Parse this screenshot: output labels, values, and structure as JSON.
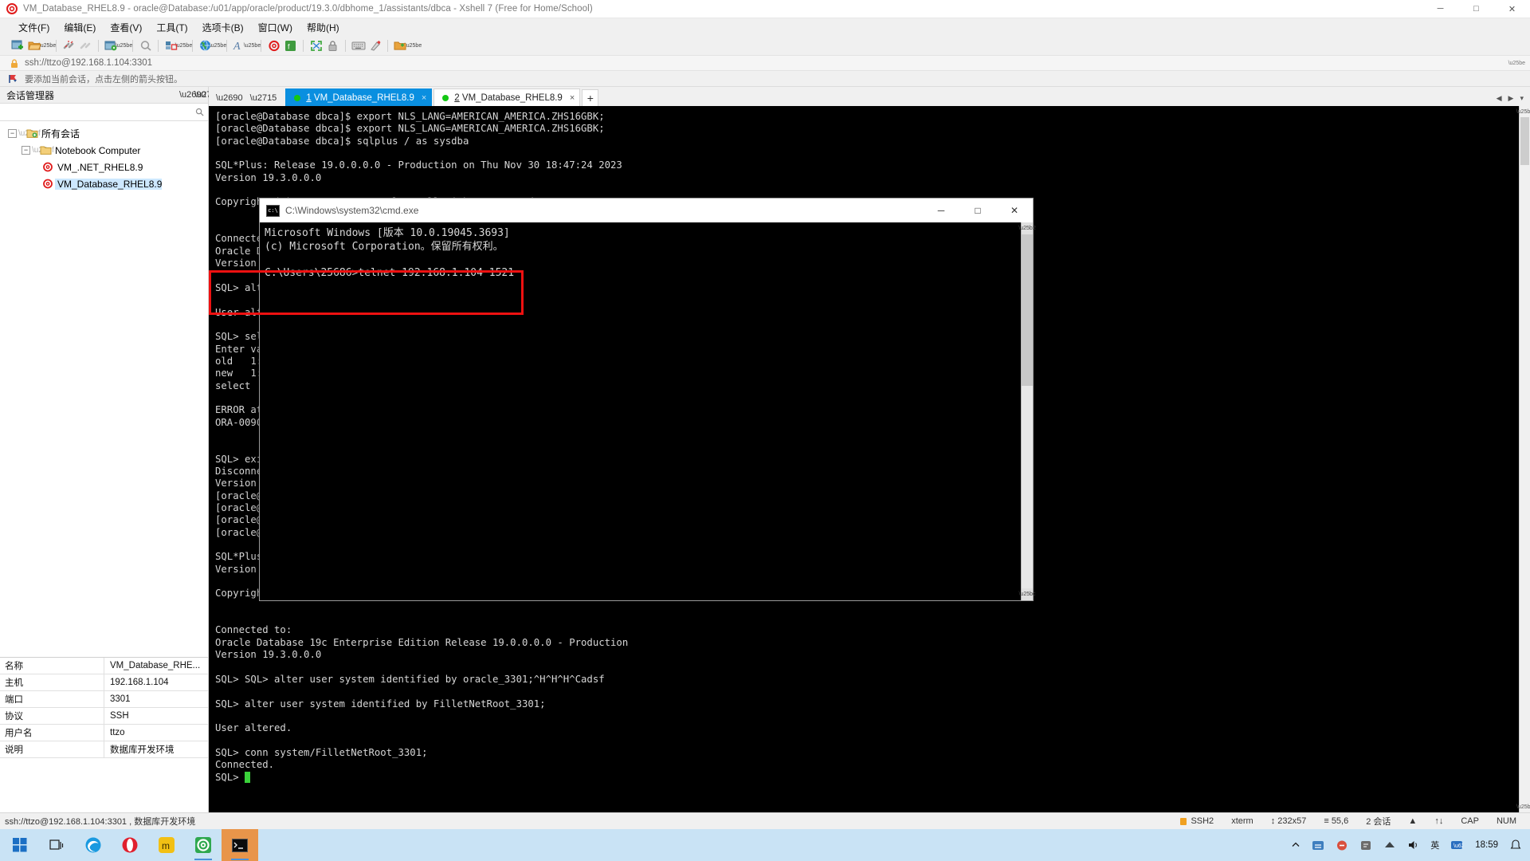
{
  "window": {
    "title": "VM_Database_RHEL8.9 - oracle@Database:/u01/app/oracle/product/19.3.0/dbhome_1/assistants/dbca - Xshell 7 (Free for Home/School)",
    "minimize": "─",
    "maximize": "□",
    "close": "✕"
  },
  "menu": {
    "items": [
      {
        "label": "文件(F)",
        "name": "menu-file"
      },
      {
        "label": "编辑(E)",
        "name": "menu-edit"
      },
      {
        "label": "查看(V)",
        "name": "menu-view"
      },
      {
        "label": "工具(T)",
        "name": "menu-tools"
      },
      {
        "label": "选项卡(B)",
        "name": "menu-tabs"
      },
      {
        "label": "窗口(W)",
        "name": "menu-window"
      },
      {
        "label": "帮助(H)",
        "name": "menu-help"
      }
    ]
  },
  "address": {
    "url": "ssh://ttzo@192.168.1.104:3301",
    "lock_icon": "lock-icon",
    "dropdown_icon": "chevron-down-icon"
  },
  "hint": {
    "text": "要添加当前会话，点击左侧的箭头按钮。",
    "icon": "arrow-flag-icon"
  },
  "sidebar": {
    "title": "会话管理器",
    "pin_icon": "pin-icon",
    "close_icon": "close-icon",
    "search_placeholder": "",
    "search_value": "",
    "search_icon": "search-icon",
    "tree": [
      {
        "label": "所有会话",
        "level": 0,
        "expander": "−",
        "icon": "folder-sessions-icon",
        "selected": false
      },
      {
        "label": "Notebook Computer",
        "level": 1,
        "expander": "−",
        "icon": "folder-icon",
        "selected": false
      },
      {
        "label": "VM_.NET_RHEL8.9",
        "level": 2,
        "expander": "",
        "icon": "session-icon",
        "selected": false
      },
      {
        "label": "VM_Database_RHEL8.9",
        "level": 2,
        "expander": "",
        "icon": "session-icon",
        "selected": true
      }
    ],
    "properties": [
      {
        "key": "名称",
        "value": "VM_Database_RHE..."
      },
      {
        "key": "主机",
        "value": "192.168.1.104"
      },
      {
        "key": "端口",
        "value": "3301"
      },
      {
        "key": "协议",
        "value": "SSH"
      },
      {
        "key": "用户名",
        "value": "ttzo"
      },
      {
        "key": "说明",
        "value": "数据库开发环境"
      }
    ]
  },
  "tabs": {
    "pin_icon": "pin-icon",
    "close_icon": "close-icon",
    "items": [
      {
        "num": "1",
        "label": " VM_Database_RHEL8.9",
        "active": true,
        "close": "×",
        "status": "connected"
      },
      {
        "num": "2",
        "label": " VM_Database_RHEL8.9",
        "active": false,
        "close": "×",
        "status": "connected"
      }
    ],
    "add_label": "+",
    "nav_left": "◀",
    "nav_right": "▶",
    "list_icon": "▾"
  },
  "terminal": {
    "lines": [
      "[oracle@Database dbca]$ export NLS_LANG=AMERICAN_AMERICA.ZHS16GBK;",
      "[oracle@Database dbca]$ export NLS_LANG=AMERICAN_AMERICA.ZHS16GBK;",
      "[oracle@Database dbca]$ sqlplus / as sysdba",
      "",
      "SQL*Plus: Release 19.0.0.0.0 - Production on Thu Nov 30 18:47:24 2023",
      "Version 19.3.0.0.0",
      "",
      "Copyright (c) 1982, 2019, Oracle.  All rights reserved.",
      "",
      "",
      "Connected to:",
      "Oracle Database 19c Enterprise Edition Release 19.0.0.0.0 - Production",
      "Version 19.3.0.0.0",
      "",
      "SQL> alter user system identified by oracle_3301;",
      "",
      "User altered.",
      "",
      "SQL> select * from v$version;",
      "Enter value for 1:",
      "old   1: select",
      "new   1: select",
      "select",
      "",
      "ERROR at line 1:",
      "ORA-00900: invalid SQL statement",
      "",
      "",
      "SQL> exit",
      "Disconnected from Oracle Database 19c Enterprise Edition Release 19.0.0.0.0",
      "Version 19.3.0.0.0",
      "[oracle@Database dbca]$",
      "[oracle@Database dbca]$",
      "[oracle@Database dbca]$",
      "[oracle@Database dbca]$ sqlplus / as sysdba",
      "",
      "SQL*Plus: Release 19.0.0.0.0 - Production on Thu Nov 30 18:52:01 2023",
      "Version 19.3.0.0.0",
      "",
      "Copyright (c) 1982, 2019, Oracle.  All rights reserved.",
      "",
      "",
      "Connected to:",
      "Oracle Database 19c Enterprise Edition Release 19.0.0.0.0 - Production",
      "Version 19.3.0.0.0",
      "",
      "SQL> SQL> alter user system identified by oracle_3301;^H^H^H^Cadsf",
      "",
      "SQL> alter user system identified by FilletNetRoot_3301;",
      "",
      "User altered.",
      "",
      "SQL> conn system/FilletNetRoot_3301;",
      "Connected.",
      "SQL> "
    ],
    "cursor": "▃"
  },
  "cmd_window": {
    "title": "C:\\Windows\\system32\\cmd.exe",
    "icon": "cmd-icon",
    "minimize": "─",
    "maximize": "□",
    "close": "✕",
    "lines": [
      "Microsoft Windows [版本 10.0.19045.3693]",
      "(c) Microsoft Corporation。保留所有权利。",
      "",
      "C:\\Users\\25686>telnet 192.168.1.104 1521"
    ],
    "highlight_color": "#ee1111"
  },
  "statusbar": {
    "left": "ssh://ttzo@192.168.1.104:3301 , 数据库开发环境",
    "items": [
      {
        "label": "SSH2",
        "name": "status-protocol",
        "icon": "lock-icon"
      },
      {
        "label": "xterm",
        "name": "status-terminal-type",
        "icon": ""
      },
      {
        "label": "↕ 232x57",
        "name": "status-size",
        "icon": ""
      },
      {
        "label": "≡ 55,6",
        "name": "status-cursor-pos",
        "icon": ""
      },
      {
        "label": "2 会话",
        "name": "status-session-count",
        "icon": ""
      },
      {
        "label": "▲",
        "name": "status-expand",
        "icon": ""
      },
      {
        "label": "↑↓",
        "name": "status-transfer",
        "icon": ""
      },
      {
        "label": "CAP",
        "name": "status-caps",
        "icon": ""
      },
      {
        "label": "NUM",
        "name": "status-num",
        "icon": ""
      }
    ]
  },
  "taskbar": {
    "start_icon": "windows-start-icon",
    "search_icon": "task-view-icon",
    "apps": [
      {
        "name": "taskbar-edge",
        "icon": "edge-icon",
        "running": false
      },
      {
        "name": "taskbar-opera",
        "icon": "opera-icon",
        "running": false
      },
      {
        "name": "taskbar-app3",
        "icon": "app-icon",
        "running": false
      },
      {
        "name": "taskbar-xshell",
        "icon": "xshell-icon",
        "running": true
      },
      {
        "name": "taskbar-cmd",
        "icon": "cmd-icon",
        "running": true
      }
    ],
    "tray": [
      {
        "name": "tray-expand",
        "label": "▲"
      },
      {
        "name": "tray-network",
        "label": ""
      },
      {
        "name": "tray-volume",
        "label": ""
      },
      {
        "name": "tray-ime",
        "label": "英"
      },
      {
        "name": "tray-input",
        "label": ""
      }
    ],
    "clock_time": "18:59",
    "clock_date": ""
  }
}
